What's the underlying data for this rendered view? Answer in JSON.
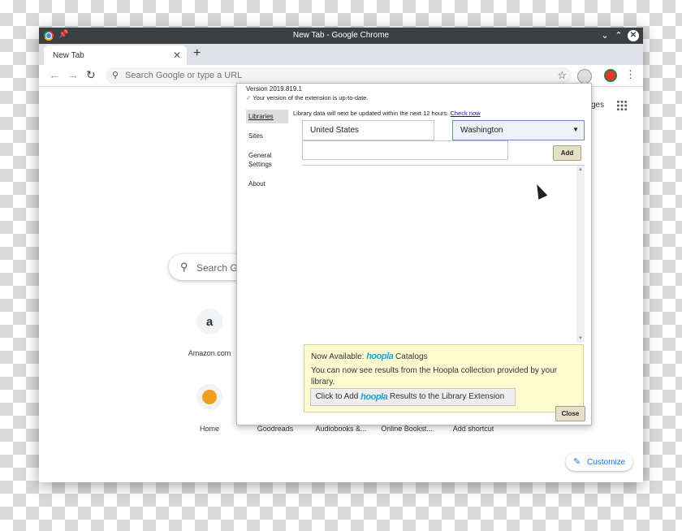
{
  "window": {
    "title": "New Tab - Google Chrome"
  },
  "tabs": [
    {
      "label": "New Tab"
    }
  ],
  "omnibox": {
    "placeholder": "Search Google or type a URL"
  },
  "ntp": {
    "images_link": "ges",
    "search_placeholder": "Search Go",
    "shortcuts": [
      {
        "label": "Amazon.com",
        "icon_text": "a"
      },
      {
        "label": "Home",
        "icon_text": ""
      },
      {
        "label": "Goodreads"
      },
      {
        "label": "Audiobooks &..."
      },
      {
        "label": "Online Bookst..."
      },
      {
        "label": "Add shortcut"
      }
    ],
    "customize_label": "Customize"
  },
  "popup": {
    "version": "Version 2019.819.1",
    "up_to_date": "Your version of the extension is up-to-date.",
    "nav": [
      "Libraries",
      "Sites",
      "General Settings",
      "About"
    ],
    "update_note": "Library data will next be updated within the next 12 hours.",
    "check_now": "Check now",
    "country": "United States",
    "state": "Washington",
    "library_input_value": "",
    "add_label": "Add",
    "hoopla": {
      "now_available": "Now Available:",
      "logo": "hoopla",
      "catalogs": "Catalogs",
      "description": "You can now see results from the Hoopla collection provided by your library.",
      "click_to_add": "Click to Add",
      "results_to": "Results to the Library Extension"
    },
    "close_label": "Close"
  },
  "colors": {
    "accent": "#1a73e8",
    "hoopla": "#18a4d8",
    "notice_bg": "#fffbd0",
    "titlebar": "#3c4043"
  }
}
